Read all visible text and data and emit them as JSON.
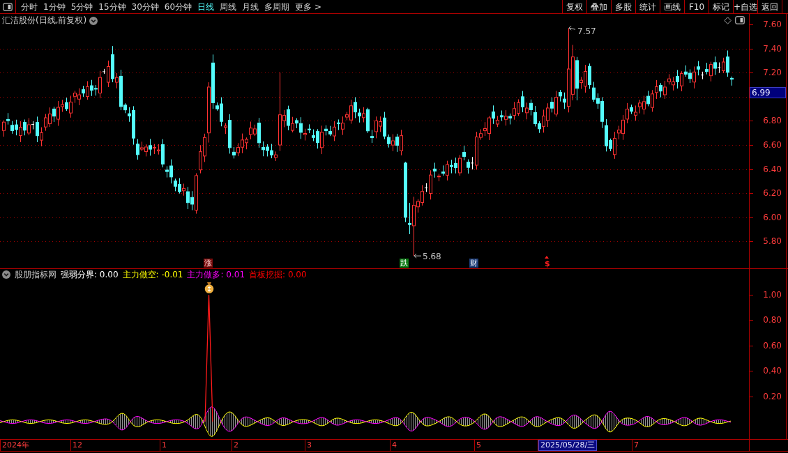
{
  "toolbar": {
    "periods": [
      {
        "label": "分时",
        "selected": false
      },
      {
        "label": "1分钟",
        "selected": false
      },
      {
        "label": "5分钟",
        "selected": false
      },
      {
        "label": "15分钟",
        "selected": false
      },
      {
        "label": "30分钟",
        "selected": false
      },
      {
        "label": "60分钟",
        "selected": false
      },
      {
        "label": "日线",
        "selected": true
      },
      {
        "label": "周线",
        "selected": false
      },
      {
        "label": "月线",
        "selected": false
      },
      {
        "label": "多周期",
        "selected": false
      },
      {
        "label": "更多 >",
        "selected": false
      }
    ],
    "actions": [
      "复权",
      "叠加",
      "多股",
      "统计",
      "画线",
      "F10",
      "标记",
      "+自选",
      "返回"
    ]
  },
  "price_chart": {
    "title": "汇洁股份(日线,前复权)",
    "high_label": "7.57",
    "low_label": "5.68",
    "events": [
      {
        "label": "涨",
        "kind": "rise"
      },
      {
        "label": "跌",
        "kind": "fall"
      },
      {
        "label": "财",
        "kind": "finance"
      },
      {
        "label": "$",
        "kind": "dividend"
      }
    ],
    "axis": [
      {
        "kind": "tick",
        "label": "7.60"
      },
      {
        "kind": "tick",
        "label": "7.40"
      },
      {
        "kind": "tick",
        "label": "7.20"
      },
      {
        "kind": "price_tag",
        "label": "6.99"
      },
      {
        "kind": "tick",
        "label": "6.80"
      },
      {
        "kind": "tick",
        "label": "6.60"
      },
      {
        "kind": "tick",
        "label": "6.40"
      },
      {
        "kind": "tick",
        "label": "6.20"
      },
      {
        "kind": "tick",
        "label": "6.00"
      },
      {
        "kind": "tick",
        "label": "5.80"
      }
    ]
  },
  "indicator": {
    "name": "股朋指标网",
    "values": [
      {
        "label": "强弱分界: 0.00",
        "color": "#ffffff"
      },
      {
        "label": "主力做空: -0.01",
        "color": "#ffff00"
      },
      {
        "label": "主力做多: 0.01",
        "color": "#ff00ff"
      },
      {
        "label": "首板挖掘: 0.00",
        "color": "#ff0000"
      }
    ],
    "axis": [
      "1.00",
      "0.80",
      "0.60",
      "0.40",
      "0.20"
    ]
  },
  "date_axis": [
    {
      "label": "2024年",
      "highlighted": false
    },
    {
      "label": "12",
      "highlighted": false
    },
    {
      "label": "1",
      "highlighted": false
    },
    {
      "label": "2",
      "highlighted": false
    },
    {
      "label": "3",
      "highlighted": false
    },
    {
      "label": "4",
      "highlighted": false
    },
    {
      "label": "5",
      "highlighted": false
    },
    {
      "label": "2025/05/28/三",
      "highlighted": true
    },
    {
      "label": "7",
      "highlighted": false
    }
  ]
}
